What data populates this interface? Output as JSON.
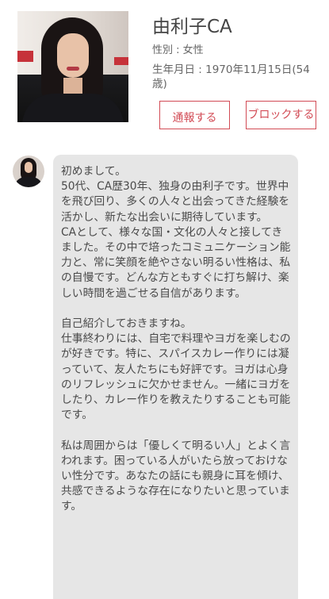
{
  "profile": {
    "name": "由利子CA",
    "gender": "性別 : 女性",
    "birth": "生年月日 : 1970年11月15日(54歳)"
  },
  "actions": {
    "report_label": "通報する",
    "block_label": "ブロックする"
  },
  "message": {
    "text": "初めまして。\n50代、CA歴30年、独身の由利子です。世界中を飛び回り、多くの人々と出会ってきた経験を活かし、新たな出会いに期待しています。\nCAとして、様々な国・文化の人々と接してきました。その中で培ったコミュニケーション能力と、常に笑顔を絶やさない明るい性格は、私の自慢です。どんな方ともすぐに打ち解け、楽しい時間を過ごせる自信があります。\n\n自己紹介しておきますね。\n仕事終わりには、自宅で料理やヨガを楽しむのが好きです。特に、スパイスカレー作りには凝っていて、友人たちにも好評です。ヨガは心身のリフレッシュに欠かせません。一緒にヨガをしたり、カレー作りを教えたりすることも可能です。\n\n私は周囲からは「優しくて明るい人」とよく言われます。困っている人がいたら放っておけない性分です。あなたの話にも親身に耳を傾け、共感できるような存在になりたいと思っています。"
  }
}
